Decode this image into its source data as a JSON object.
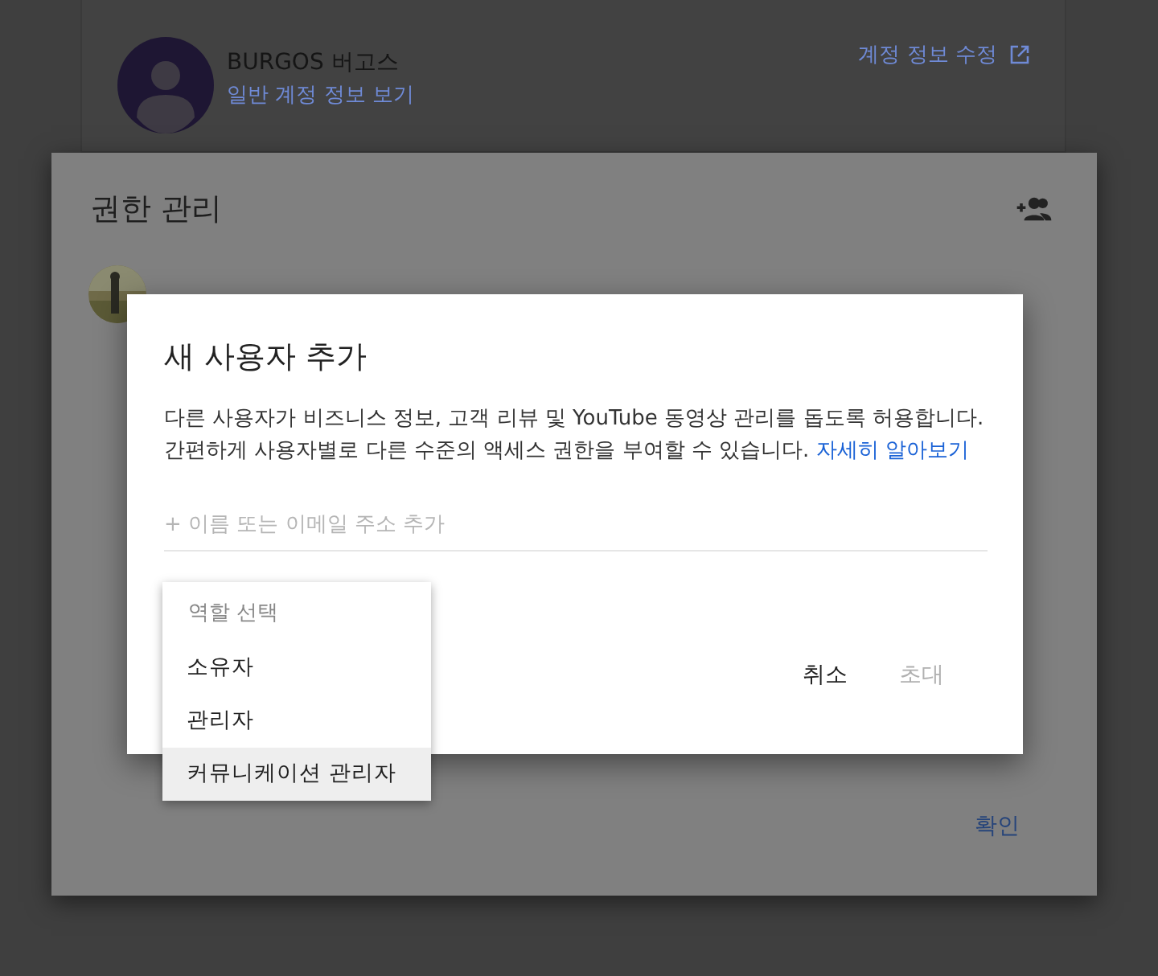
{
  "account_card": {
    "name": "BURGOS 버고스",
    "profile_link": "일반 계정 정보 보기",
    "edit_link": "계정 정보 수정"
  },
  "permissions_dialog": {
    "title": "권한 관리",
    "confirm_button": "확인"
  },
  "add_user_dialog": {
    "title": "새 사용자 추가",
    "description": "다른 사용자가 비즈니스 정보, 고객 리뷰 및 YouTube 동영상 관리를 돕도록 허용합니다. 간편하게 사용자별로 다른 수준의 액세스 권한을 부여할 수 있습니다.",
    "learn_more_link": "자세히 알아보기",
    "input": {
      "placeholder": "+ 이름 또는 이메일 주소 추가"
    },
    "buttons": [
      {
        "label": "취소",
        "disabled": false
      },
      {
        "label": "초대",
        "disabled": true
      }
    ]
  },
  "role_menu": {
    "title": "역할 선택",
    "options": [
      {
        "label": "소유자",
        "selected": false
      },
      {
        "label": "관리자",
        "selected": false
      },
      {
        "label": "커뮤니케이션 관리자",
        "selected": true
      }
    ]
  }
}
